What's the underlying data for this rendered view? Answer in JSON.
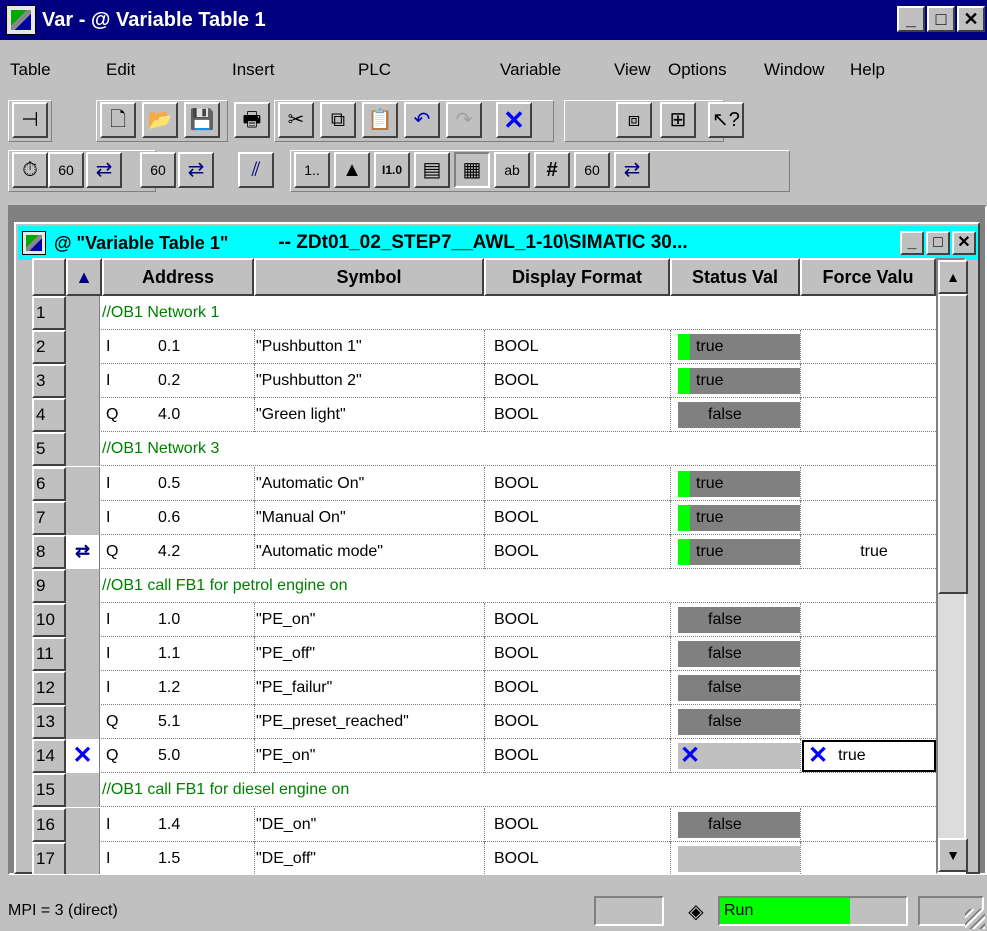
{
  "window": {
    "title": "Var - @ Variable Table 1"
  },
  "menu": [
    "Table",
    "Edit",
    "Insert",
    "PLC",
    "Variable",
    "View",
    "Options",
    "Window",
    "Help"
  ],
  "child_window": {
    "title": "@ \"Variable Table 1\"",
    "path": "-- ZDt01_02_STEP7__AWL_1-10\\SIMATIC 30..."
  },
  "columns": [
    "Address",
    "Symbol",
    "Display Format",
    "Status Val",
    "Force Valu"
  ],
  "rows": [
    {
      "num": "1",
      "comment": "//OB1 Network 1"
    },
    {
      "num": "2",
      "op": "I",
      "addr": "0.1",
      "symbol": "\"Pushbutton 1\"",
      "format": "BOOL",
      "status": "true",
      "status_state": "on",
      "force": ""
    },
    {
      "num": "3",
      "op": "I",
      "addr": "0.2",
      "symbol": "\"Pushbutton 2\"",
      "format": "BOOL",
      "status": "true",
      "status_state": "on",
      "force": ""
    },
    {
      "num": "4",
      "op": "Q",
      "addr": "4.0",
      "symbol": "\"Green light\"",
      "format": "BOOL",
      "status": "false",
      "status_state": "off",
      "force": ""
    },
    {
      "num": "5",
      "comment": "//OB1 Network 3"
    },
    {
      "num": "6",
      "op": "I",
      "addr": "0.5",
      "symbol": "\"Automatic On\"",
      "format": "BOOL",
      "status": "true",
      "status_state": "on",
      "force": ""
    },
    {
      "num": "7",
      "op": "I",
      "addr": "0.6",
      "symbol": "\"Manual On\"",
      "format": "BOOL",
      "status": "true",
      "status_state": "on",
      "force": ""
    },
    {
      "num": "8",
      "op": "Q",
      "addr": "4.2",
      "symbol": "\"Automatic mode\"",
      "format": "BOOL",
      "status": "true",
      "status_state": "on",
      "force": "true",
      "marker": "force-icon"
    },
    {
      "num": "9",
      "comment": "//OB1 call FB1 for petrol engine on"
    },
    {
      "num": "10",
      "op": "I",
      "addr": "1.0",
      "symbol": "\"PE_on\"",
      "format": "BOOL",
      "status": "false",
      "status_state": "off",
      "force": ""
    },
    {
      "num": "11",
      "op": "I",
      "addr": "1.1",
      "symbol": "\"PE_off\"",
      "format": "BOOL",
      "status": "false",
      "status_state": "off",
      "force": ""
    },
    {
      "num": "12",
      "op": "I",
      "addr": "1.2",
      "symbol": "\"PE_failur\"",
      "format": "BOOL",
      "status": "false",
      "status_state": "off",
      "force": ""
    },
    {
      "num": "13",
      "op": "Q",
      "addr": "5.1",
      "symbol": "\"PE_preset_reached\"",
      "format": "BOOL",
      "status": "false",
      "status_state": "off",
      "force": ""
    },
    {
      "num": "14",
      "op": "Q",
      "addr": "5.0",
      "symbol": "\"PE_on\"",
      "format": "BOOL",
      "status": "",
      "status_state": "x",
      "force": "true",
      "marker": "delete-x-icon",
      "force_x": true
    },
    {
      "num": "15",
      "comment": "//OB1 call FB1 for diesel engine on"
    },
    {
      "num": "16",
      "op": "I",
      "addr": "1.4",
      "symbol": "\"DE_on\"",
      "format": "BOOL",
      "status": "false",
      "status_state": "off",
      "force": ""
    },
    {
      "num": "17",
      "op": "I",
      "addr": "1.5",
      "symbol": "\"DE_off\"",
      "format": "BOOL",
      "status": "",
      "status_state": "none",
      "force": ""
    }
  ],
  "statusbar": {
    "connection": "MPI =  3 (direct)",
    "mode": "Run"
  },
  "colors": {
    "title_bg": "#000080",
    "child_title_bg": "#00ffff",
    "status_on": "#00ff00",
    "comment": "#008000",
    "accent_x": "#0000ff"
  }
}
